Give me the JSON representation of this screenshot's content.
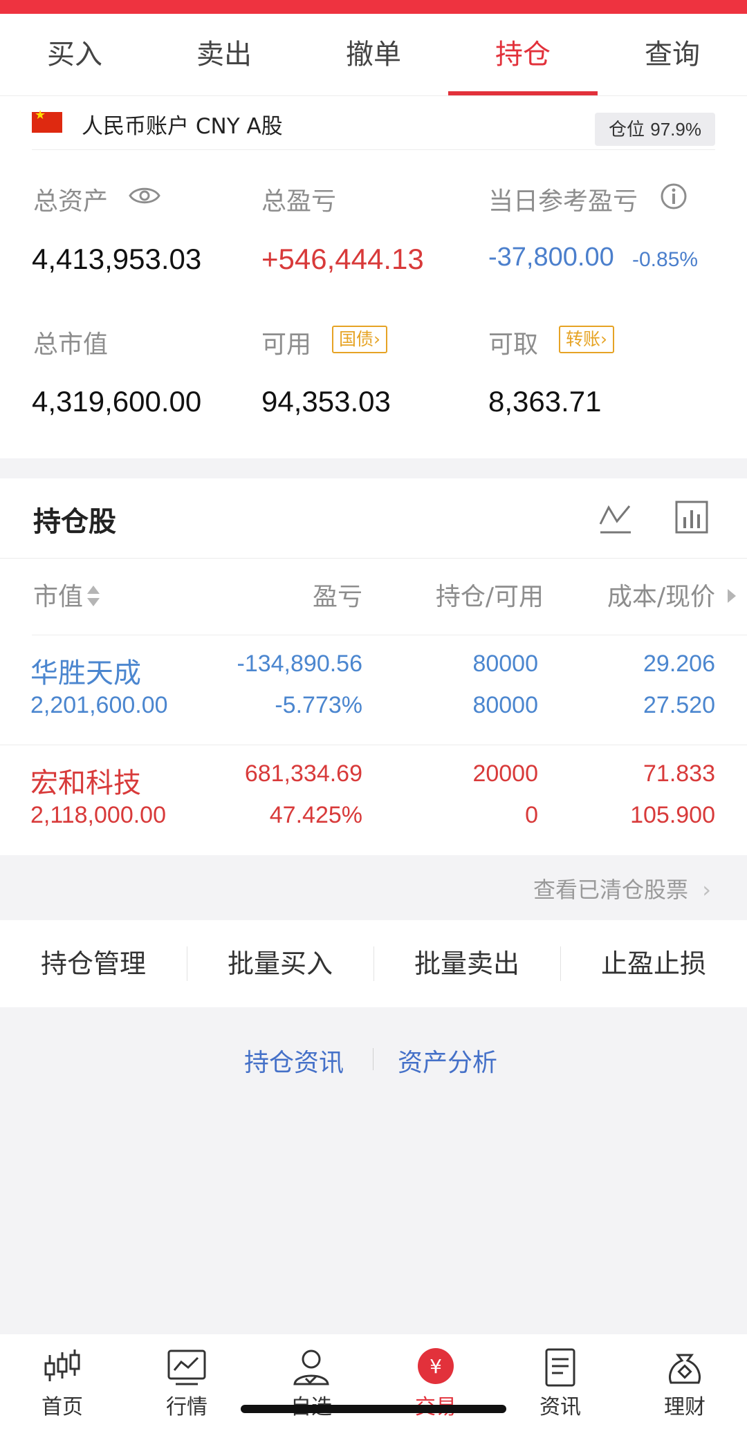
{
  "tabs": [
    "买入",
    "卖出",
    "撤单",
    "持仓",
    "查询"
  ],
  "active_tab": "持仓",
  "account": {
    "name": "人民币账户 CNY A股",
    "position_label": "仓位",
    "position_value": "97.9%",
    "total_assets_label": "总资产",
    "total_assets": "4,413,953.03",
    "total_pnl_label": "总盈亏",
    "total_pnl": "+546,444.13",
    "daily_pnl_label": "当日参考盈亏",
    "daily_pnl": "-37,800.00",
    "daily_pnl_pct": "-0.85%",
    "market_value_label": "总市值",
    "market_value": "4,319,600.00",
    "available_label": "可用",
    "available_tag": "国债",
    "available": "94,353.03",
    "withdrawable_label": "可取",
    "withdrawable_tag": "转账",
    "withdrawable": "8,363.71"
  },
  "holdings": {
    "title": "持仓股",
    "columns": [
      "市值",
      "盈亏",
      "持仓/可用",
      "成本/现价"
    ],
    "rows": [
      {
        "name": "华胜天成",
        "market_value": "2,201,600.00",
        "pnl": "-134,890.56",
        "pnl_pct": "-5.773%",
        "position": "80000",
        "available": "80000",
        "cost": "29.206",
        "price": "27.520",
        "color": "#4b86cf"
      },
      {
        "name": "宏和科技",
        "market_value": "2,118,000.00",
        "pnl": "681,334.69",
        "pnl_pct": "47.425%",
        "position": "20000",
        "available": "0",
        "cost": "71.833",
        "price": "105.900",
        "color": "#d83a3a"
      }
    ]
  },
  "cleared_link": "查看已清仓股票",
  "actions": [
    "持仓管理",
    "批量买入",
    "批量卖出",
    "止盈止损"
  ],
  "links": [
    "持仓资讯",
    "资产分析"
  ],
  "nav": [
    {
      "label": "首页",
      "icon": "candlestick-icon"
    },
    {
      "label": "行情",
      "icon": "chart-monitor-icon"
    },
    {
      "label": "自选",
      "icon": "user-check-icon"
    },
    {
      "label": "交易",
      "icon": "yen-coin-icon"
    },
    {
      "label": "资讯",
      "icon": "document-icon"
    },
    {
      "label": "理财",
      "icon": "money-bag-icon"
    }
  ],
  "active_nav": "交易",
  "colors": {
    "accent": "#e2313b",
    "up": "#d83a3a",
    "down": "#4b7fcc",
    "tag": "#e6a324"
  }
}
